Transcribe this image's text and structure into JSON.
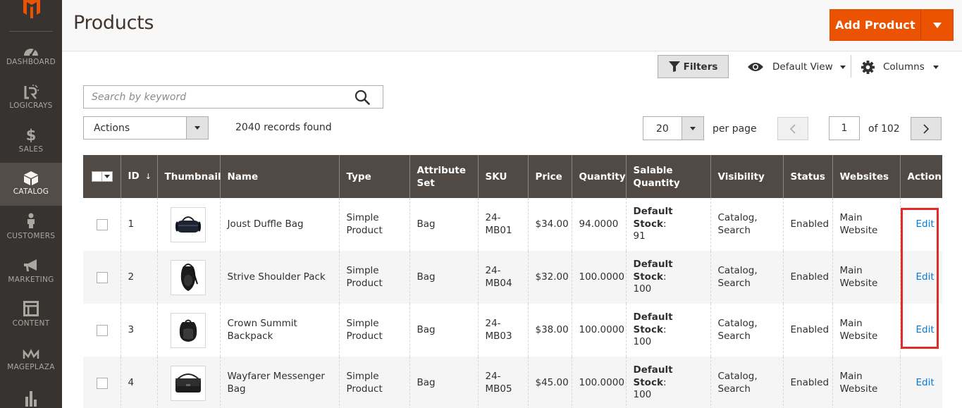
{
  "sidebar": {
    "items": [
      {
        "id": "dashboard",
        "label": "DASHBOARD",
        "icon": "speedometer-icon"
      },
      {
        "id": "logicrays",
        "label": "LOGICRAYS",
        "icon": "logicrays-icon"
      },
      {
        "id": "sales",
        "label": "SALES",
        "icon": "dollar-icon"
      },
      {
        "id": "catalog",
        "label": "CATALOG",
        "icon": "box-icon",
        "active": true
      },
      {
        "id": "customers",
        "label": "CUSTOMERS",
        "icon": "person-icon"
      },
      {
        "id": "marketing",
        "label": "MARKETING",
        "icon": "megaphone-icon"
      },
      {
        "id": "content",
        "label": "CONTENT",
        "icon": "layout-icon"
      },
      {
        "id": "mageplaza",
        "label": "MAGEPLAZA",
        "icon": "mageplaza-icon"
      },
      {
        "id": "reports",
        "label": "",
        "icon": "bar-chart-icon"
      }
    ]
  },
  "header": {
    "title": "Products",
    "add_button_label": "Add Product"
  },
  "toolbar": {
    "filters_label": "Filters",
    "view_label": "Default View",
    "columns_label": "Columns"
  },
  "search": {
    "placeholder": "Search by keyword",
    "value": ""
  },
  "actions": {
    "label": "Actions"
  },
  "records": {
    "text": "2040 records found"
  },
  "pagination": {
    "per_page": "20",
    "per_page_label": "per page",
    "current_page": "1",
    "of_pages": "of 102"
  },
  "table": {
    "columns": [
      "ID",
      "Thumbnail",
      "Name",
      "Type",
      "Attribute Set",
      "SKU",
      "Price",
      "Quantity",
      "Salable Quantity",
      "Visibility",
      "Status",
      "Websites",
      "Action"
    ],
    "sort_indicator": "↓",
    "rows": [
      {
        "id": "1",
        "thumb": "duffle-bag",
        "name": "Joust Duffle Bag",
        "type": "Simple Product",
        "attribute_set": "Bag",
        "sku": "24-MB01",
        "price": "$34.00",
        "quantity": "94.0000",
        "salable_label": "Default Stock",
        "salable_sep": ":",
        "salable_value": "91",
        "visibility": "Catalog, Search",
        "status": "Enabled",
        "websites": "Main Website",
        "action": "Edit"
      },
      {
        "id": "2",
        "thumb": "shoulder-pack",
        "name": "Strive Shoulder Pack",
        "type": "Simple Product",
        "attribute_set": "Bag",
        "sku": "24-MB04",
        "price": "$32.00",
        "quantity": "100.0000",
        "salable_label": "Default Stock",
        "salable_sep": ":",
        "salable_value": "100",
        "visibility": "Catalog, Search",
        "status": "Enabled",
        "websites": "Main Website",
        "action": "Edit"
      },
      {
        "id": "3",
        "thumb": "backpack",
        "name": "Crown Summit Backpack",
        "type": "Simple Product",
        "attribute_set": "Bag",
        "sku": "24-MB03",
        "price": "$38.00",
        "quantity": "100.0000",
        "salable_label": "Default Stock",
        "salable_sep": ":",
        "salable_value": "100",
        "visibility": "Catalog, Search",
        "status": "Enabled",
        "websites": "Main Website",
        "action": "Edit"
      },
      {
        "id": "4",
        "thumb": "messenger-bag",
        "name": "Wayfarer Messenger Bag",
        "type": "Simple Product",
        "attribute_set": "Bag",
        "sku": "24-MB05",
        "price": "$45.00",
        "quantity": "100.0000",
        "salable_label": "Default Stock",
        "salable_sep": ":",
        "salable_value": "100",
        "visibility": "Catalog, Search",
        "status": "Enabled",
        "websites": "Main Website",
        "action": "Edit"
      }
    ]
  },
  "colors": {
    "accent": "#eb5202",
    "sidebar_bg": "#373330",
    "table_header_bg": "#514943",
    "link": "#007bdb",
    "highlight": "#e02b27"
  }
}
